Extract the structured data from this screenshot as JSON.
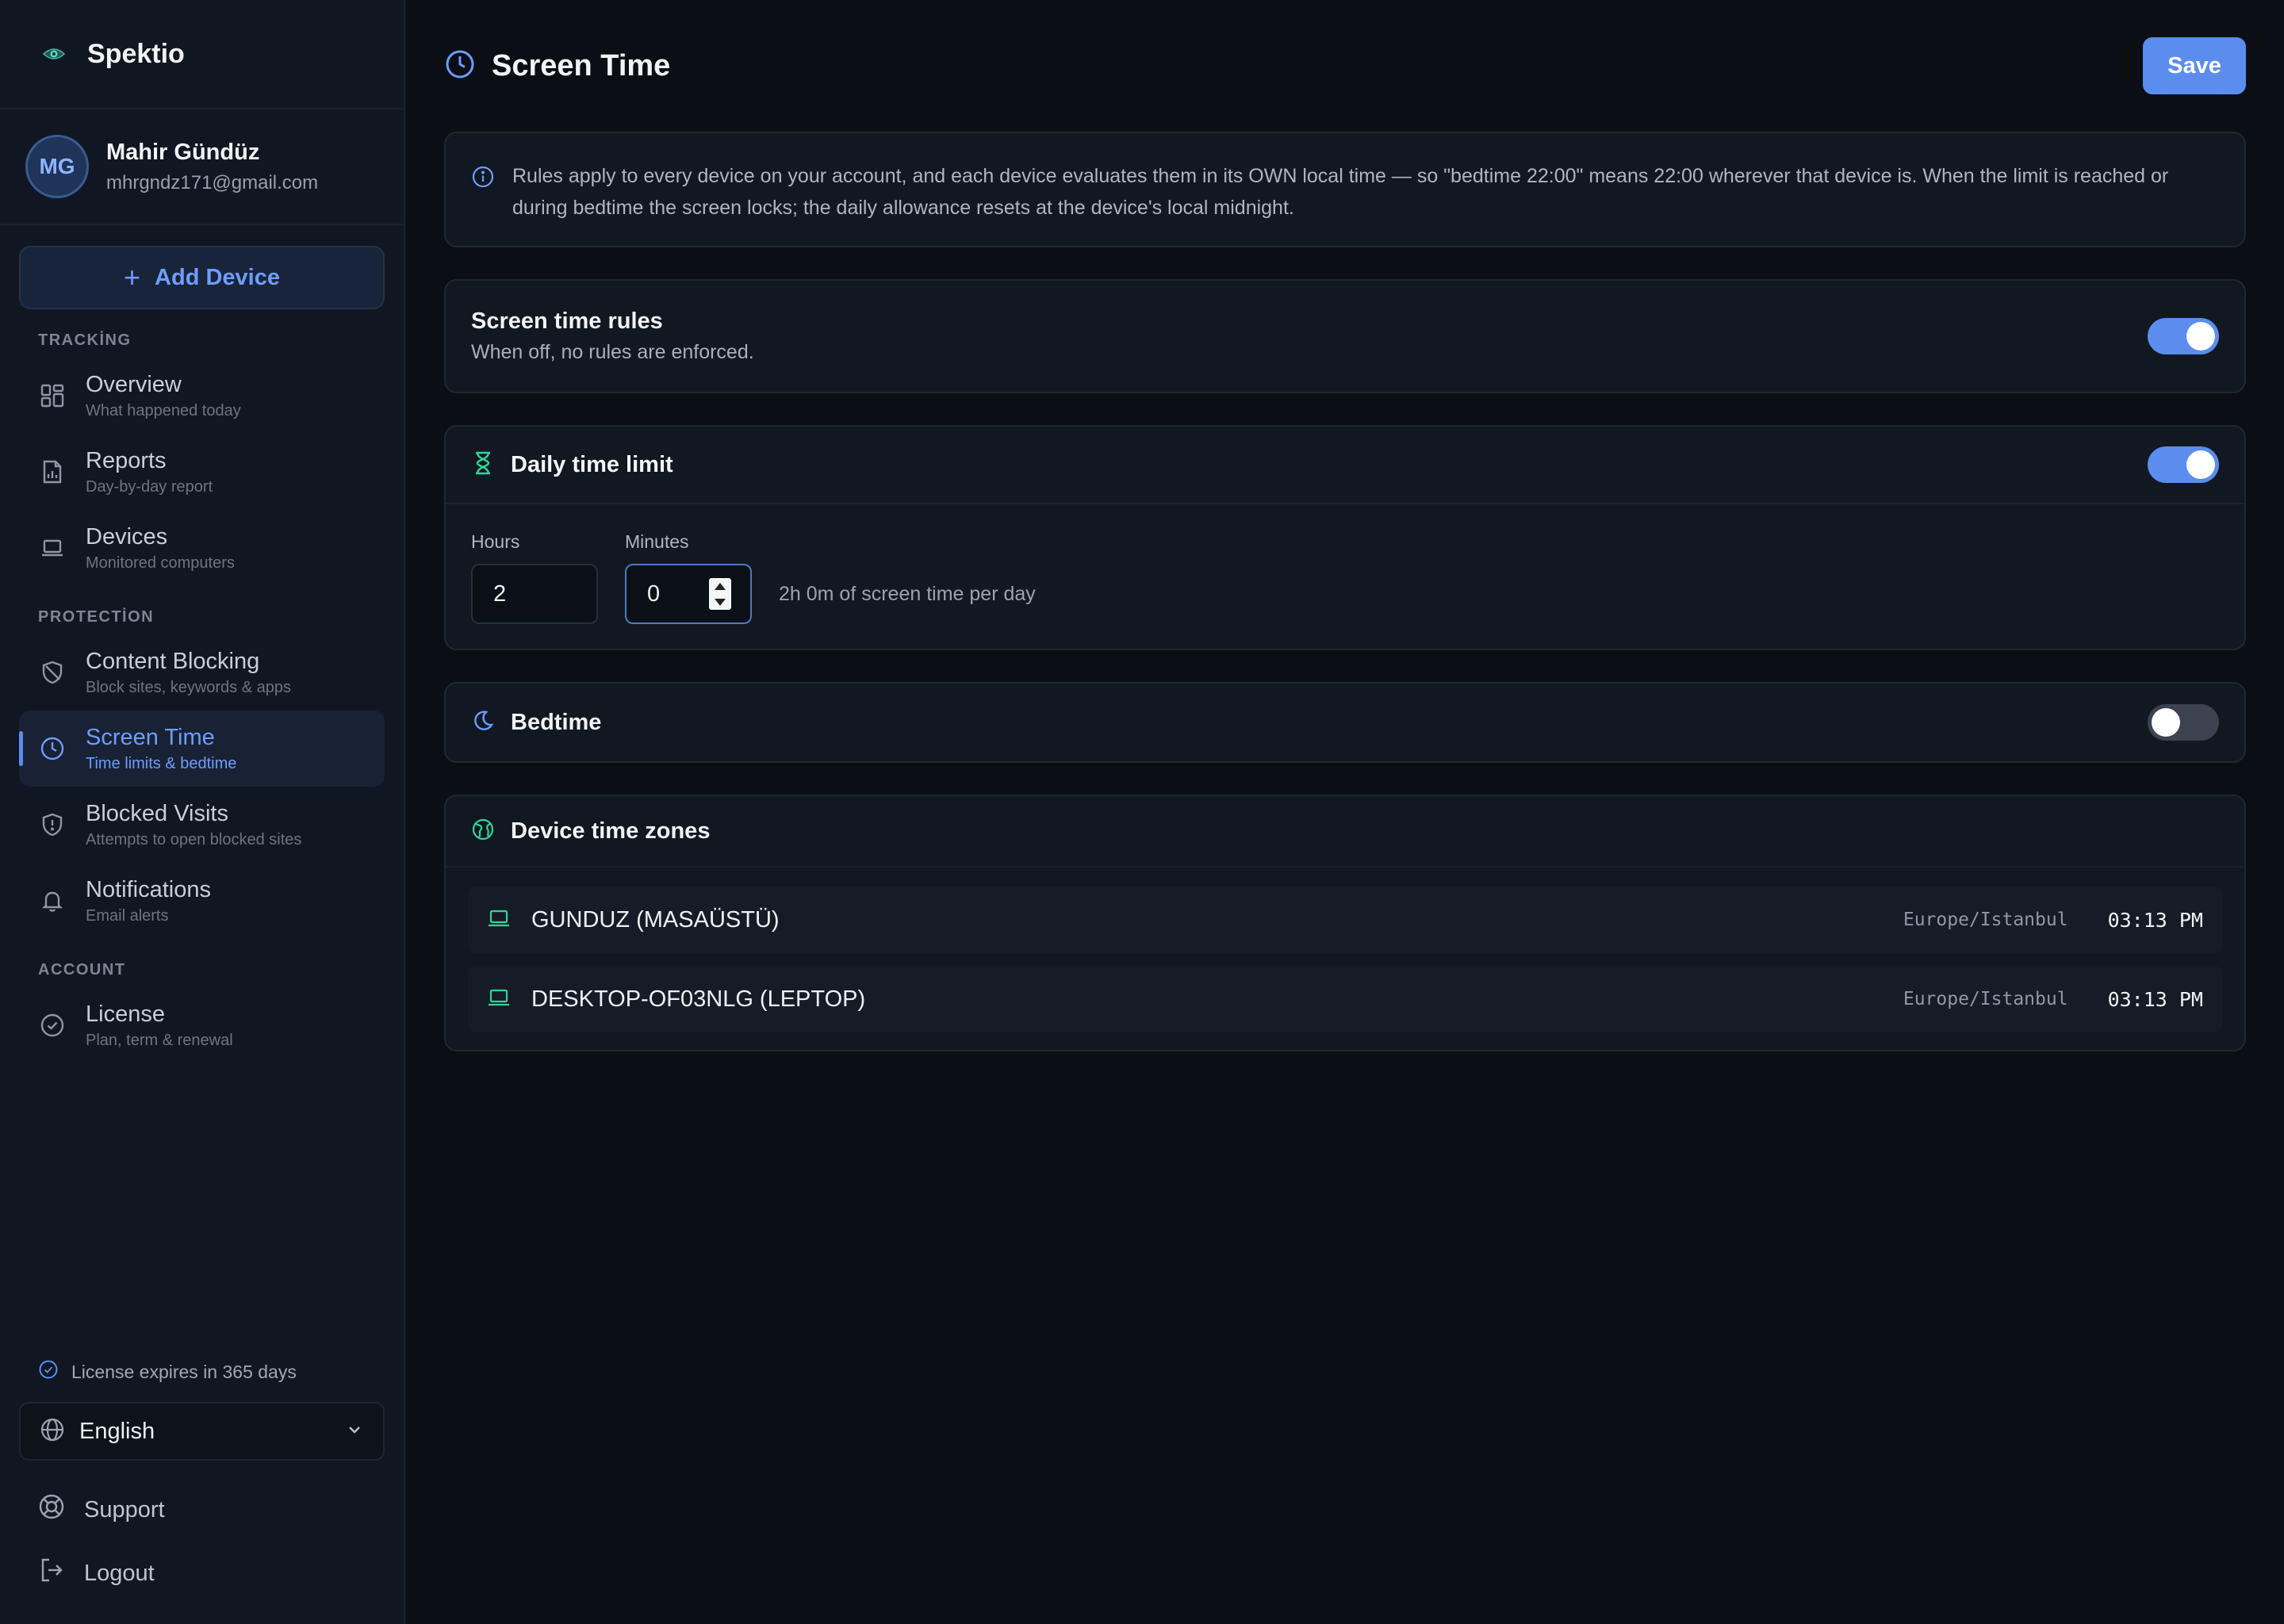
{
  "brand": {
    "name": "Spektio",
    "icon": "eye-icon"
  },
  "user": {
    "initials": "MG",
    "name": "Mahir Gündüz",
    "email": "mhrgndz171@gmail.com"
  },
  "sidebar": {
    "add_device_label": "Add Device",
    "sections": {
      "tracking": "TRACKİNG",
      "protection": "PROTECTİON",
      "account": "ACCOUNT"
    },
    "items": [
      {
        "title": "Overview",
        "sub": "What happened today",
        "icon": "grid-icon"
      },
      {
        "title": "Reports",
        "sub": "Day-by-day report",
        "icon": "report-icon"
      },
      {
        "title": "Devices",
        "sub": "Monitored computers",
        "icon": "laptop-icon"
      },
      {
        "title": "Content Blocking",
        "sub": "Block sites, keywords & apps",
        "icon": "shield-icon"
      },
      {
        "title": "Screen Time",
        "sub": "Time limits & bedtime",
        "icon": "clock-icon",
        "active": true
      },
      {
        "title": "Blocked Visits",
        "sub": "Attempts to open blocked sites",
        "icon": "shield-alert-icon"
      },
      {
        "title": "Notifications",
        "sub": "Email alerts",
        "icon": "bell-icon"
      },
      {
        "title": "License",
        "sub": "Plan, term & renewal",
        "icon": "badge-check-icon"
      }
    ],
    "license_note": "License expires in 365 days",
    "language": "English",
    "support_label": "Support",
    "logout_label": "Logout"
  },
  "header": {
    "title": "Screen Time",
    "save_label": "Save"
  },
  "info": {
    "text": "Rules apply to every device on your account, and each device evaluates them in its OWN local time — so \"bedtime 22:00\" means 22:00 wherever that device is. When the limit is reached or during bedtime the screen locks; the daily allowance resets at the device's local midnight."
  },
  "rules": {
    "title": "Screen time rules",
    "subtitle": "When off, no rules are enforced.",
    "enabled": true
  },
  "daily_limit": {
    "title": "Daily time limit",
    "enabled": true,
    "hours_label": "Hours",
    "hours_value": "2",
    "minutes_label": "Minutes",
    "minutes_value": "0",
    "summary": "2h 0m of screen time per day"
  },
  "bedtime": {
    "title": "Bedtime",
    "enabled": false
  },
  "timezones": {
    "title": "Device time zones",
    "devices": [
      {
        "name": "GUNDUZ (MASAÜSTÜ)",
        "zone": "Europe/Istanbul",
        "time": "03:13 PM"
      },
      {
        "name": "DESKTOP-OF03NLG (LEPTOP)",
        "zone": "Europe/Istanbul",
        "time": "03:13 PM"
      }
    ]
  },
  "colors": {
    "accent": "#5b8def",
    "accent_text": "#6f9cff",
    "success": "#34d399",
    "background": "#0b0e14",
    "sidebar": "#111722"
  }
}
